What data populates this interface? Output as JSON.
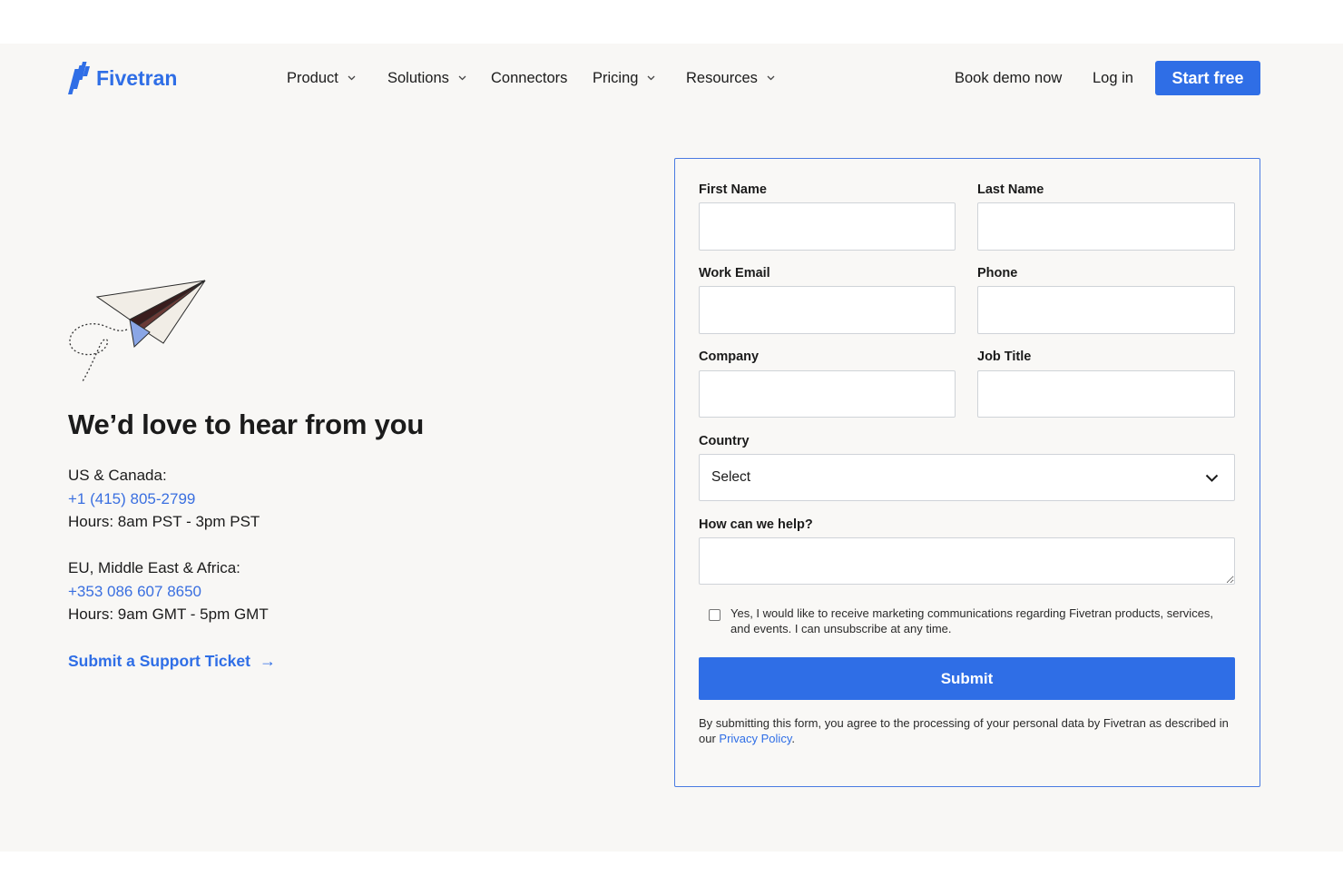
{
  "header": {
    "logo": {
      "text": "Fivetran",
      "icon": "fivetran-logo-icon"
    },
    "nav": [
      {
        "label": "Product",
        "dropdown_icon": "chevron-down-icon"
      },
      {
        "label": "Solutions",
        "dropdown_icon": "chevron-down-icon"
      },
      {
        "label": "Connectors"
      },
      {
        "label": "Pricing",
        "dropdown_icon": "chevron-down-icon"
      },
      {
        "label": "Resources",
        "dropdown_icon": "chevron-down-icon"
      }
    ],
    "book_demo_label": "Book demo now",
    "login_label": "Log in",
    "start_free_label": "Start free"
  },
  "contact": {
    "illustration": "paper-airplane-icon",
    "heading": "We’d love to hear from you",
    "regions": [
      {
        "name": "US & Canada:",
        "phone": "+1 (415) 805-2799",
        "hours": "Hours: 8am PST - 3pm PST"
      },
      {
        "name": "EU, Middle East & Africa:",
        "phone": "+353 086 607 8650",
        "hours": "Hours: 9am GMT - 5pm GMT"
      }
    ],
    "support_link": {
      "label": "Submit a Support Ticket",
      "arrow": "→"
    }
  },
  "form": {
    "fields": {
      "first_name": {
        "label": "First Name",
        "value": ""
      },
      "last_name": {
        "label": "Last Name",
        "value": ""
      },
      "work_email": {
        "label": "Work Email",
        "value": ""
      },
      "phone": {
        "label": "Phone",
        "value": ""
      },
      "company": {
        "label": "Company",
        "value": ""
      },
      "job_title": {
        "label": "Job Title",
        "value": ""
      },
      "country": {
        "label": "Country",
        "value": "Select",
        "icon": "chevron-down-icon"
      },
      "help": {
        "label": "How can we help?",
        "value": ""
      }
    },
    "consent": {
      "checked": false,
      "text": "Yes, I would like to receive marketing communications regarding Fivetran products, services, and events. I can unsubscribe at any time."
    },
    "submit_label": "Submit",
    "disclaimer": {
      "text": "By submitting this form, you agree to the processing of your personal data by Fivetran as described in our ",
      "link": "Privacy Policy",
      "suffix": "."
    }
  },
  "colors": {
    "brand_blue": "#2f6ee6",
    "page_background": "#f8f7f5",
    "text": "#1b1b1b",
    "input_border": "#cfd3d8",
    "form_border": "#4a7be2"
  }
}
